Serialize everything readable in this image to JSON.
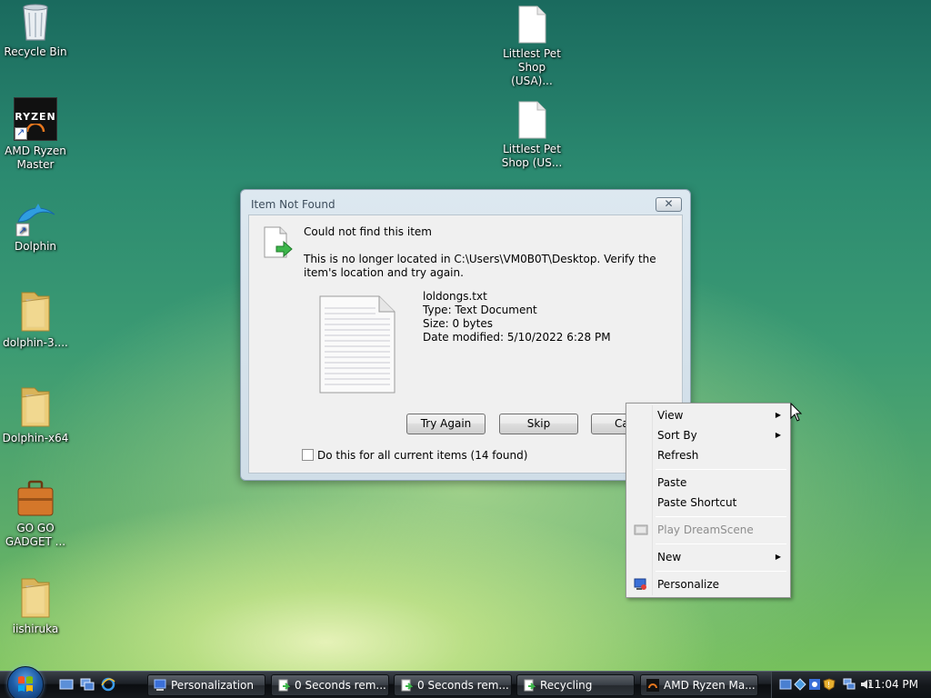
{
  "desktop_icons": [
    {
      "label": "Recycle Bin",
      "icon": "recycle-bin-icon"
    },
    {
      "label": "AMD Ryzen Master",
      "icon": "amd-ryzen-master-icon",
      "logo_text": "RYZEN"
    },
    {
      "label": "Dolphin",
      "icon": "dolphin-icon"
    },
    {
      "label": "dolphin-3....",
      "icon": "folder-icon"
    },
    {
      "label": "Dolphin-x64",
      "icon": "folder-icon"
    },
    {
      "label": "GO GO GADGET ...",
      "icon": "briefcase-icon"
    },
    {
      "label": "iishiruka",
      "icon": "folder-icon"
    },
    {
      "label": "Littlest Pet Shop (USA)...",
      "icon": "document-icon"
    },
    {
      "label": "Littlest Pet Shop (US...",
      "icon": "document-icon"
    }
  ],
  "dialog": {
    "title": "Item Not Found",
    "close_label": "✕",
    "heading": "Could not find this item",
    "message": "This is no longer located in C:\\Users\\VM0B0T\\Desktop. Verify the item's location and try again.",
    "file": {
      "name": "loldongs.txt",
      "type": "Type: Text Document",
      "size": "Size: 0 bytes",
      "modified": "Date modified: 5/10/2022 6:28 PM"
    },
    "buttons": {
      "try_again": "Try Again",
      "skip": "Skip",
      "cancel": "Ca"
    },
    "checkbox_label": "Do this for all current items (14 found)"
  },
  "context_menu": {
    "items": [
      {
        "label": "View",
        "submenu": true
      },
      {
        "label": "Sort By",
        "submenu": true
      },
      {
        "label": "Refresh"
      },
      {
        "label": "Paste"
      },
      {
        "label": "Paste Shortcut"
      },
      {
        "label": "Play DreamScene",
        "disabled": true
      },
      {
        "label": "New",
        "submenu": true
      },
      {
        "label": "Personalize"
      }
    ]
  },
  "taskbar": {
    "tasks": [
      {
        "label": "Personalization",
        "icon": "personalization-icon"
      },
      {
        "label": "0 Seconds rem...",
        "icon": "file-copy-icon"
      },
      {
        "label": "0 Seconds rem...",
        "icon": "file-copy-icon"
      },
      {
        "label": "Recycling",
        "icon": "file-copy-icon"
      },
      {
        "label": "AMD Ryzen Ma...",
        "icon": "amd-ryzen-icon"
      }
    ],
    "clock": "11:04 PM"
  }
}
